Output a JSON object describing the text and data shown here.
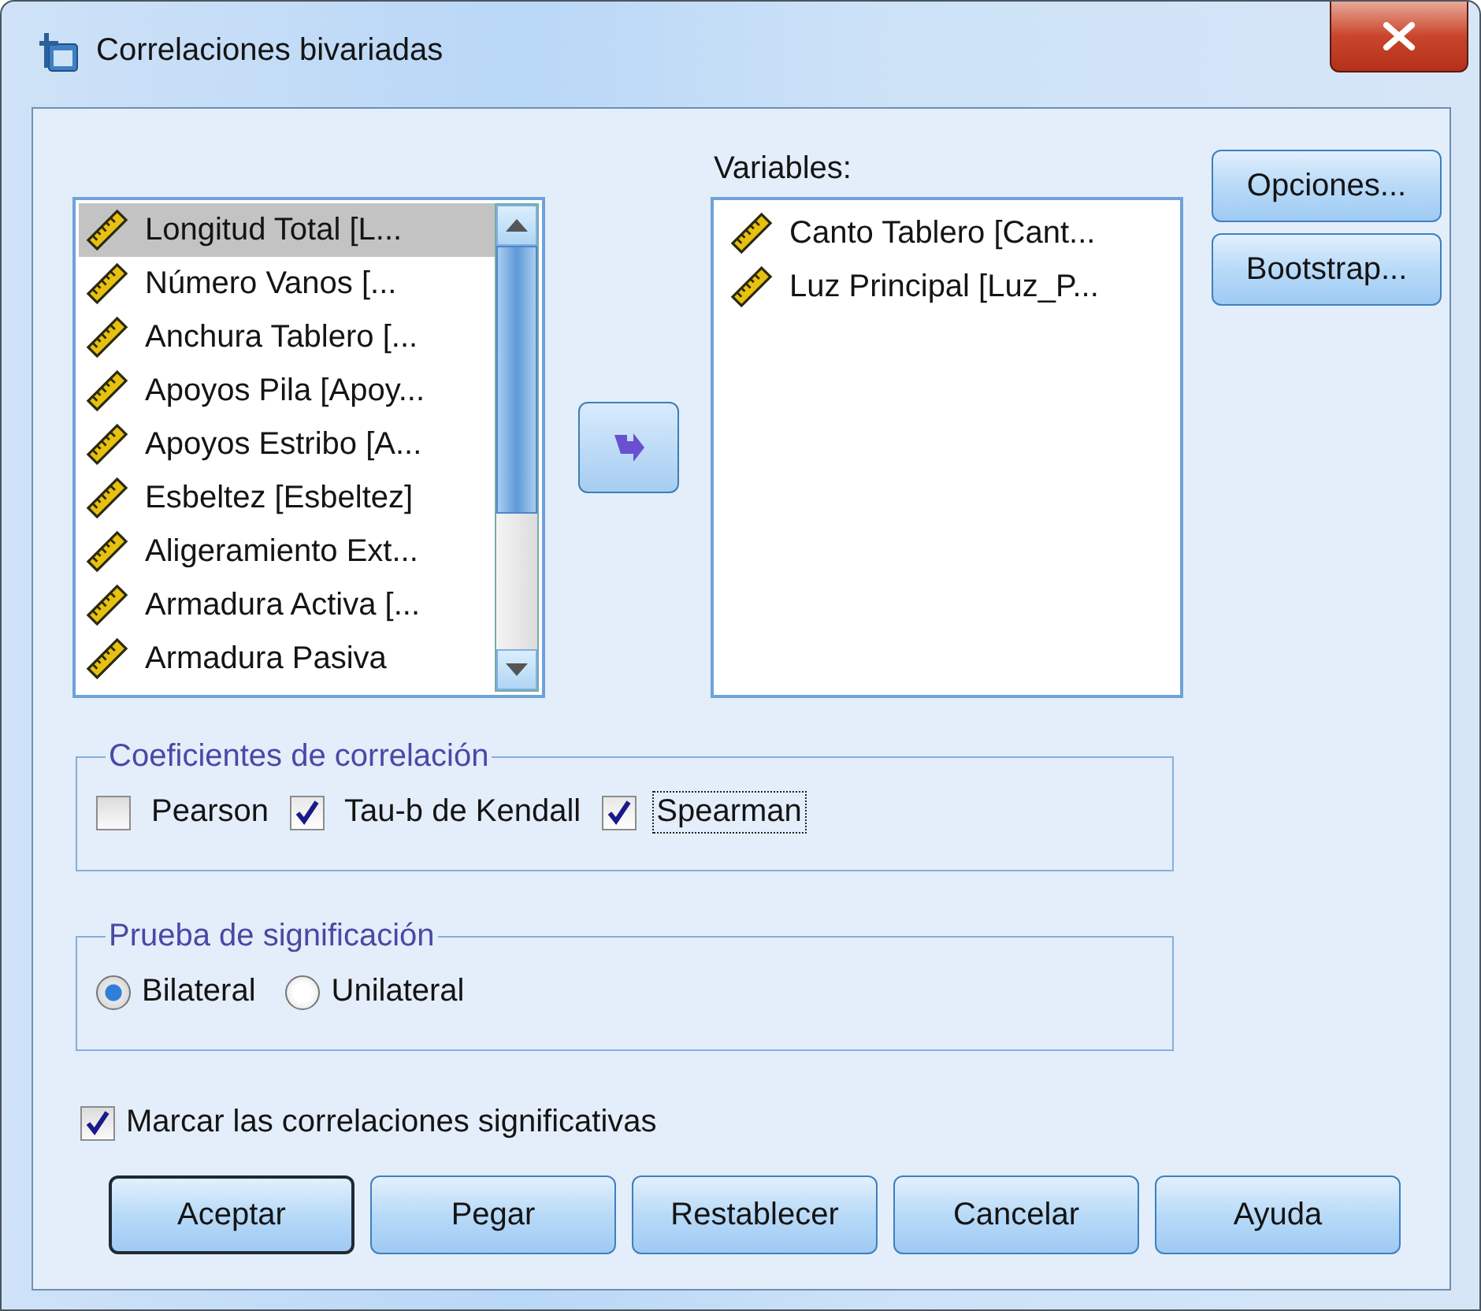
{
  "window": {
    "title": "Correlaciones bivariadas"
  },
  "source_list": {
    "items": [
      {
        "label": "Longitud Total [L...",
        "selected": true
      },
      {
        "label": "Número Vanos [...",
        "selected": false
      },
      {
        "label": "Anchura Tablero [...",
        "selected": false
      },
      {
        "label": "Apoyos Pila [Apoy...",
        "selected": false
      },
      {
        "label": "Apoyos Estribo [A...",
        "selected": false
      },
      {
        "label": "Esbeltez [Esbeltez]",
        "selected": false
      },
      {
        "label": "Aligeramiento Ext...",
        "selected": false
      },
      {
        "label": "Armadura Activa [...",
        "selected": false
      },
      {
        "label": "Armadura Pasiva",
        "selected": false
      }
    ]
  },
  "target_list": {
    "label": "Variables:",
    "items": [
      {
        "label": "Canto Tablero [Cant..."
      },
      {
        "label": "Luz Principal [Luz_P..."
      }
    ]
  },
  "side_buttons": [
    {
      "label": "Opciones..."
    },
    {
      "label": "Bootstrap..."
    }
  ],
  "coefficients": {
    "title": "Coeficientes de correlación",
    "options": [
      {
        "label": "Pearson",
        "checked": false,
        "focused": false
      },
      {
        "label": "Tau-b de Kendall",
        "checked": true,
        "focused": false
      },
      {
        "label": "Spearman",
        "checked": true,
        "focused": true
      }
    ]
  },
  "significance": {
    "title": "Prueba de significación",
    "options": [
      {
        "label": "Bilateral",
        "selected": true
      },
      {
        "label": "Unilateral",
        "selected": false
      }
    ]
  },
  "flag_option": {
    "label": "Marcar las correlaciones significativas",
    "checked": true
  },
  "buttons": [
    {
      "label": "Aceptar",
      "default": true
    },
    {
      "label": "Pegar",
      "default": false
    },
    {
      "label": "Restablecer",
      "default": false
    },
    {
      "label": "Cancelar",
      "default": false
    },
    {
      "label": "Ayuda",
      "default": false
    }
  ]
}
